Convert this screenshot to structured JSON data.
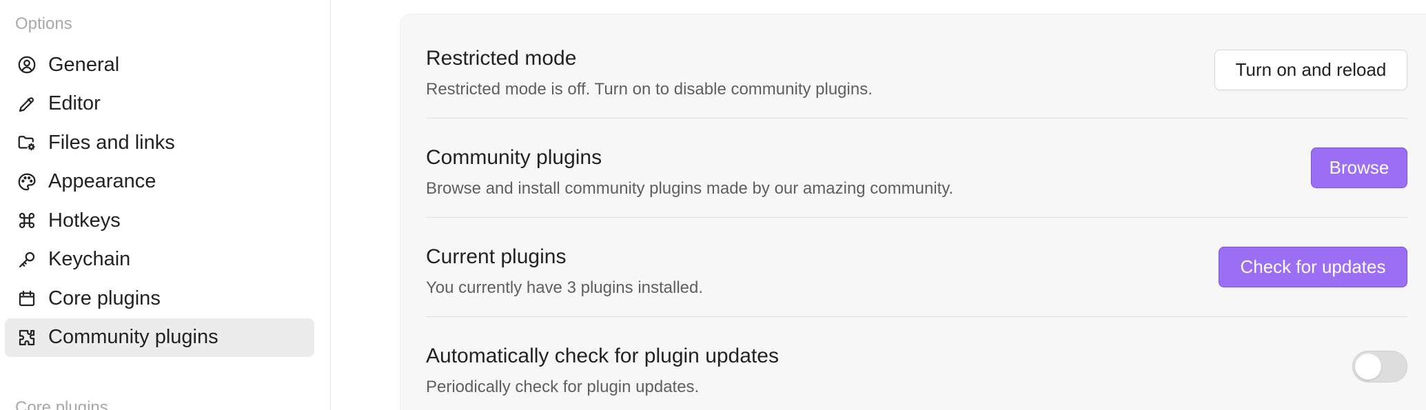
{
  "sidebar": {
    "section_options": "Options",
    "section_core_plugins": "Core plugins",
    "items": [
      {
        "label": "General",
        "icon": "user-circle-icon"
      },
      {
        "label": "Editor",
        "icon": "pencil-icon"
      },
      {
        "label": "Files and links",
        "icon": "folder-gear-icon"
      },
      {
        "label": "Appearance",
        "icon": "palette-icon"
      },
      {
        "label": "Hotkeys",
        "icon": "command-icon"
      },
      {
        "label": "Keychain",
        "icon": "key-icon"
      },
      {
        "label": "Core plugins",
        "icon": "calendar-box-icon"
      },
      {
        "label": "Community plugins",
        "icon": "puzzle-icon",
        "active": true
      }
    ]
  },
  "settings": [
    {
      "title": "Restricted mode",
      "description": "Restricted mode is off. Turn on to disable community plugins.",
      "button_label": "Turn on and reload"
    },
    {
      "title": "Community plugins",
      "description": "Browse and install community plugins made by our amazing community.",
      "button_label": "Browse"
    },
    {
      "title": "Current plugins",
      "description": "You currently have 3 plugins installed.",
      "button_label": "Check for updates"
    },
    {
      "title": "Automatically check for plugin updates",
      "description": "Periodically check for plugin updates.",
      "toggle_state": "off"
    }
  ],
  "colors": {
    "accent": "#9b6ef3",
    "sidebar_active_bg": "#ececec",
    "content_bg": "#f7f7f7"
  }
}
